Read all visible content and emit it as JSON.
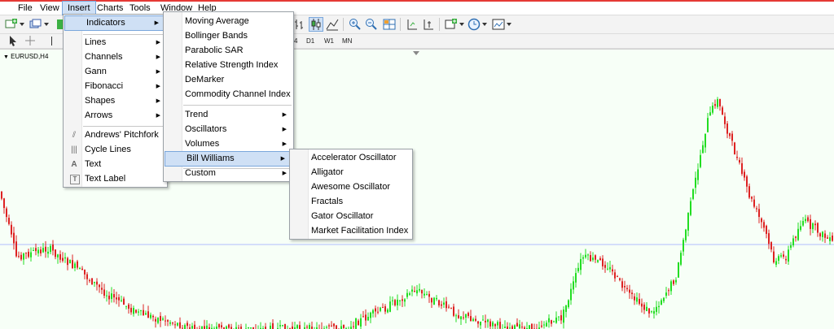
{
  "menubar": {
    "items": [
      "File",
      "View",
      "Insert",
      "Charts",
      "Tools",
      "Window",
      "Help"
    ],
    "active_index": 2
  },
  "timeframes": [
    "4",
    "D1",
    "W1",
    "MN"
  ],
  "chart": {
    "symbol": "EURUSD,H4",
    "colors": {
      "background": "#f7fff7",
      "up": "#22dd22",
      "down": "#dd2222",
      "level": "#9aa8ff"
    }
  },
  "insert_menu": {
    "groups": [
      [
        {
          "label": "Indicators",
          "submenu": true,
          "highlighted": true
        }
      ],
      [
        {
          "label": "Lines",
          "submenu": true
        },
        {
          "label": "Channels",
          "submenu": true
        },
        {
          "label": "Gann",
          "submenu": true
        },
        {
          "label": "Fibonacci",
          "submenu": true
        },
        {
          "label": "Shapes",
          "submenu": true
        },
        {
          "label": "Arrows",
          "submenu": true
        }
      ],
      [
        {
          "label": "Andrews' Pitchfork",
          "icon": "pitchfork-icon"
        },
        {
          "label": "Cycle Lines",
          "icon": "cycle-lines-icon"
        },
        {
          "label": "Text",
          "icon": "text-icon"
        },
        {
          "label": "Text Label",
          "icon": "text-label-icon"
        }
      ]
    ]
  },
  "indicators_menu": {
    "groups": [
      [
        {
          "label": "Moving Average"
        },
        {
          "label": "Bollinger Bands"
        },
        {
          "label": "Parabolic SAR"
        },
        {
          "label": "Relative Strength Index"
        },
        {
          "label": "DeMarker"
        },
        {
          "label": "Commodity Channel Index"
        }
      ],
      [
        {
          "label": "Trend",
          "submenu": true
        },
        {
          "label": "Oscillators",
          "submenu": true
        },
        {
          "label": "Volumes",
          "submenu": true
        },
        {
          "label": "Bill Williams",
          "submenu": true,
          "highlighted": true
        }
      ],
      [
        {
          "label": "Custom",
          "submenu": true
        }
      ]
    ]
  },
  "bill_williams_menu": {
    "items": [
      {
        "label": "Accelerator Oscillator"
      },
      {
        "label": "Alligator"
      },
      {
        "label": "Awesome Oscillator"
      },
      {
        "label": "Fractals"
      },
      {
        "label": "Gator Oscillator"
      },
      {
        "label": "Market Facilitation Index"
      }
    ]
  }
}
